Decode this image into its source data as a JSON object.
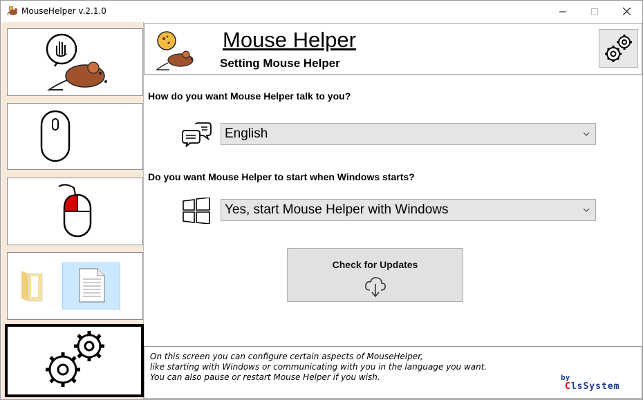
{
  "window": {
    "title": "MouseHelper v.2.1.0"
  },
  "sidebar": {
    "items": [
      {
        "name": "about",
        "icon": "hand-mouse-icon"
      },
      {
        "name": "mouse",
        "icon": "mouse-outline-icon"
      },
      {
        "name": "click",
        "icon": "mouse-left-click-icon"
      },
      {
        "name": "files",
        "icon": "folder-document-icon"
      },
      {
        "name": "settings",
        "icon": "gears-icon",
        "selected": true
      }
    ]
  },
  "header": {
    "title": "Mouse Helper",
    "subtitle": "Setting Mouse Helper"
  },
  "language": {
    "question": "How do you want Mouse Helper talk to you?",
    "selected": "English"
  },
  "startup": {
    "question": "Do you want Mouse Helper to start when Windows starts?",
    "selected": "Yes, start Mouse Helper with Windows"
  },
  "updates": {
    "label": "Check for Updates"
  },
  "footer": {
    "line1": "On this screen you can configure certain aspects of MouseHelper,",
    "line2": "like starting with Windows or communicating with you in the language you want.",
    "line3": "You can also pause or restart Mouse Helper if you wish.",
    "brand_by": "by",
    "brand_first": "C",
    "brand_rest": "lsSystem"
  },
  "colors": {
    "sidebar_bg": "#f7e9da",
    "mouse_brown": "#a0522d",
    "accent_red": "#d60000",
    "brand_blue": "#1a3a8f"
  }
}
